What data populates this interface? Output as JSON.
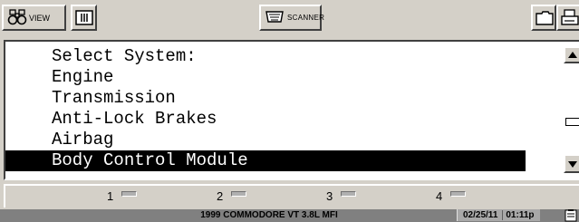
{
  "toolbar": {
    "view_label": "VIEW",
    "view_icon": "binoculars-icon",
    "split_icon": "split-screen-icon",
    "scanner_label": "SCANNER",
    "scanner_icon": "scanner-connector-icon",
    "folder_icon": "folder-icon",
    "print_icon": "printer-icon"
  },
  "menu": {
    "items": [
      {
        "label": "Select System:",
        "selected": false
      },
      {
        "label": "Engine",
        "selected": false
      },
      {
        "label": "Transmission",
        "selected": false
      },
      {
        "label": "Anti-Lock Brakes",
        "selected": false
      },
      {
        "label": "Airbag",
        "selected": false
      },
      {
        "label": "Body Control Module",
        "selected": true
      }
    ]
  },
  "fkeys": [
    {
      "label": "1"
    },
    {
      "label": "2"
    },
    {
      "label": "3"
    },
    {
      "label": "4"
    }
  ],
  "status": {
    "vehicle": "1999 COMMODORE VT 3.8L MFI",
    "date": "02/25/11",
    "time": "01:11p"
  },
  "colors": {
    "panel_bg": "#d4d0c8",
    "selection_bg": "#000000",
    "selection_fg": "#ffffff",
    "status_bg": "#808080"
  }
}
